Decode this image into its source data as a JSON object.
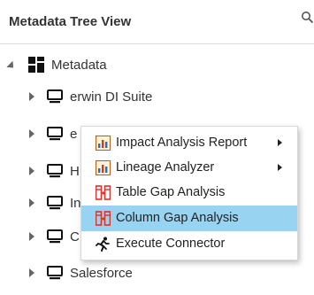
{
  "header": {
    "title": "Metadata Tree View",
    "search_icon": "search-icon"
  },
  "tree": {
    "root": {
      "label": "Metadata",
      "icon": "grid-icon",
      "expanded": true
    },
    "items": [
      {
        "label": "erwin DI Suite",
        "icon": "monitor-icon"
      },
      {
        "label": "e",
        "icon": "monitor-icon"
      },
      {
        "label": "H",
        "icon": "monitor-icon"
      },
      {
        "label": "In",
        "icon": "monitor-icon"
      },
      {
        "label": "C",
        "icon": "monitor-icon"
      },
      {
        "label": "Salesforce",
        "icon": "monitor-icon"
      }
    ]
  },
  "context_menu": {
    "items": [
      {
        "label": "Impact Analysis Report",
        "icon": "report-icon",
        "has_submenu": true,
        "selected": false
      },
      {
        "label": "Lineage Analyzer",
        "icon": "report-icon",
        "has_submenu": true,
        "selected": false
      },
      {
        "label": "Table Gap Analysis",
        "icon": "gap-analysis-icon",
        "has_submenu": false,
        "selected": false
      },
      {
        "label": "Column Gap Analysis",
        "icon": "gap-analysis-icon",
        "has_submenu": false,
        "selected": true
      },
      {
        "label": "Execute Connector",
        "icon": "run-icon",
        "has_submenu": false,
        "selected": false
      }
    ]
  },
  "colors": {
    "selected_bg": "#99d3f2",
    "gap_icon": "#d9332b",
    "report_icon_blue": "#2f6fb5"
  }
}
